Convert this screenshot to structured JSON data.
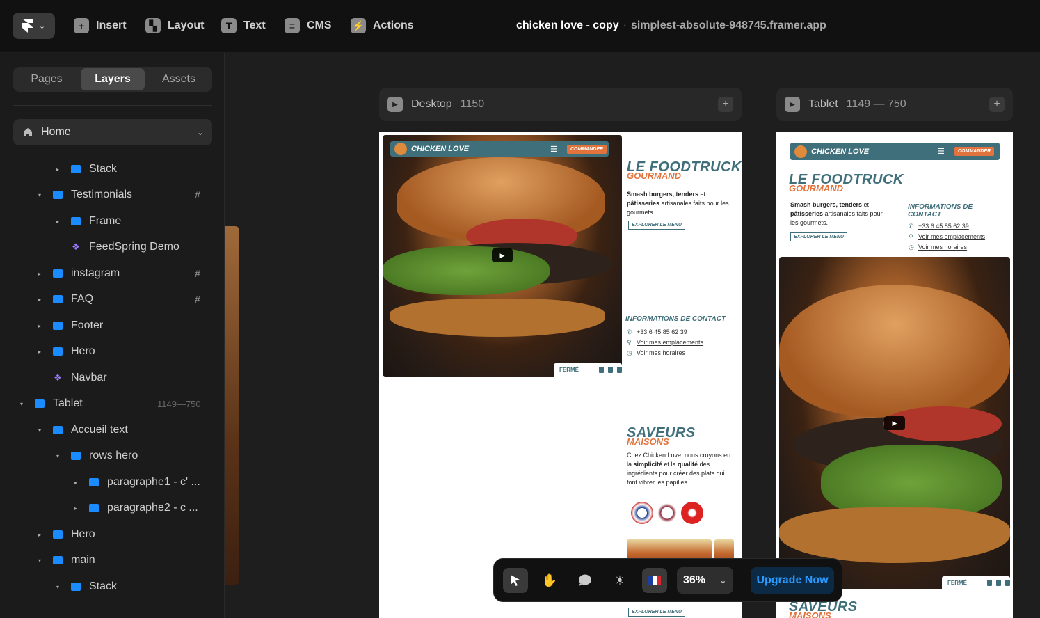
{
  "topbar": {
    "menu": [
      {
        "label": "Insert",
        "icon": "plus-icon"
      },
      {
        "label": "Layout",
        "icon": "layout-icon"
      },
      {
        "label": "Text",
        "icon": "text-icon"
      },
      {
        "label": "CMS",
        "icon": "database-icon"
      },
      {
        "label": "Actions",
        "icon": "bolt-icon"
      }
    ],
    "project_name": "chicken love - copy",
    "separator": "·",
    "site_url": "simplest-absolute-948745.framer.app"
  },
  "sidebar": {
    "tabs": [
      "Pages",
      "Layers",
      "Assets"
    ],
    "active_tab": "Layers",
    "page_select": "Home",
    "layers": [
      {
        "label": "Stack",
        "icon": "stack-icon",
        "color": "blue",
        "depth": 2,
        "arrow": "▸"
      },
      {
        "label": "Testimonials",
        "icon": "stack-icon",
        "color": "blue",
        "depth": 1,
        "arrow": "▾",
        "badge": "#"
      },
      {
        "label": "Frame",
        "icon": "frame-icon",
        "color": "blue",
        "depth": 2,
        "arrow": "▸"
      },
      {
        "label": "FeedSpring Demo",
        "icon": "component-icon",
        "color": "purple",
        "depth": 2,
        "arrow": ""
      },
      {
        "label": "instagram",
        "icon": "stack-icon",
        "color": "blue",
        "depth": 1,
        "arrow": "▸",
        "badge": "#"
      },
      {
        "label": "FAQ",
        "icon": "stack-icon",
        "color": "blue",
        "depth": 1,
        "arrow": "▸",
        "badge": "#"
      },
      {
        "label": "Footer",
        "icon": "stack-icon",
        "color": "blue",
        "depth": 1,
        "arrow": "▸"
      },
      {
        "label": "Hero",
        "icon": "frame-icon",
        "color": "blue",
        "depth": 1,
        "arrow": "▸"
      },
      {
        "label": "Navbar",
        "icon": "component-icon",
        "color": "purple",
        "depth": 1,
        "arrow": ""
      },
      {
        "label": "Tablet",
        "icon": "stack-icon",
        "color": "blue",
        "depth": 0,
        "arrow": "▾",
        "dims": "1149—750"
      },
      {
        "label": "Accueil text",
        "icon": "frame-icon",
        "color": "blue",
        "depth": 1,
        "arrow": "▾"
      },
      {
        "label": "rows hero",
        "icon": "grid-icon",
        "color": "blue",
        "depth": 2,
        "arrow": "▾"
      },
      {
        "label": "paragraphe1 - c' ...",
        "icon": "stack-icon",
        "color": "blue",
        "depth": 3,
        "arrow": "▸"
      },
      {
        "label": "paragraphe2 - c ...",
        "icon": "stack-icon",
        "color": "blue",
        "depth": 3,
        "arrow": "▸"
      },
      {
        "label": "Hero",
        "icon": "frame-icon",
        "color": "blue",
        "depth": 1,
        "arrow": "▸"
      },
      {
        "label": "main",
        "icon": "stack-icon",
        "color": "blue",
        "depth": 1,
        "arrow": "▾"
      },
      {
        "label": "Stack",
        "icon": "stack-icon",
        "color": "blue",
        "depth": 2,
        "arrow": "▾"
      }
    ]
  },
  "canvas": {
    "desktop": {
      "name": "Desktop",
      "width_label": "1150"
    },
    "tablet": {
      "name": "Tablet",
      "width_label": "1149 — 750"
    },
    "site": {
      "brand": "CHICKEN LOVE",
      "order_button": "COMMANDER",
      "headline": "LE FOODTRUCK",
      "headline_sub": "GOURMAND",
      "intro_html_parts": [
        "Smash burgers, tenders",
        " et ",
        "pâtisseries",
        " artisanales faits pour les gourmets."
      ],
      "explore_button": "EXPLORER LE MENU",
      "contact_heading": "INFORMATIONS DE CONTACT",
      "phone": "+33 6 45 85 62 39",
      "locations_link": "Voir mes emplacements",
      "hours_link": "Voir mes horaires",
      "status": "FERMÉ",
      "flavors_heading": "SAVEURS",
      "flavors_sub": "MAISONS",
      "flavors_text_parts": [
        "Chez Chicken Love, nous croyons en la ",
        "simplicité",
        " et la ",
        "qualité",
        " des ingrédients pour créer des plats qui font vibrer les papilles."
      ]
    }
  },
  "toolbar": {
    "tools": [
      "pointer-icon",
      "hand-icon",
      "comment-icon",
      "sun-icon",
      "flag-icon"
    ],
    "zoom": "36%",
    "upgrade_label": "Upgrade Now"
  },
  "colors": {
    "accent": "#1a8cff",
    "brand_teal": "#3f6f7a",
    "brand_orange": "#e2733c",
    "upgrade_text": "#2a9bff"
  }
}
